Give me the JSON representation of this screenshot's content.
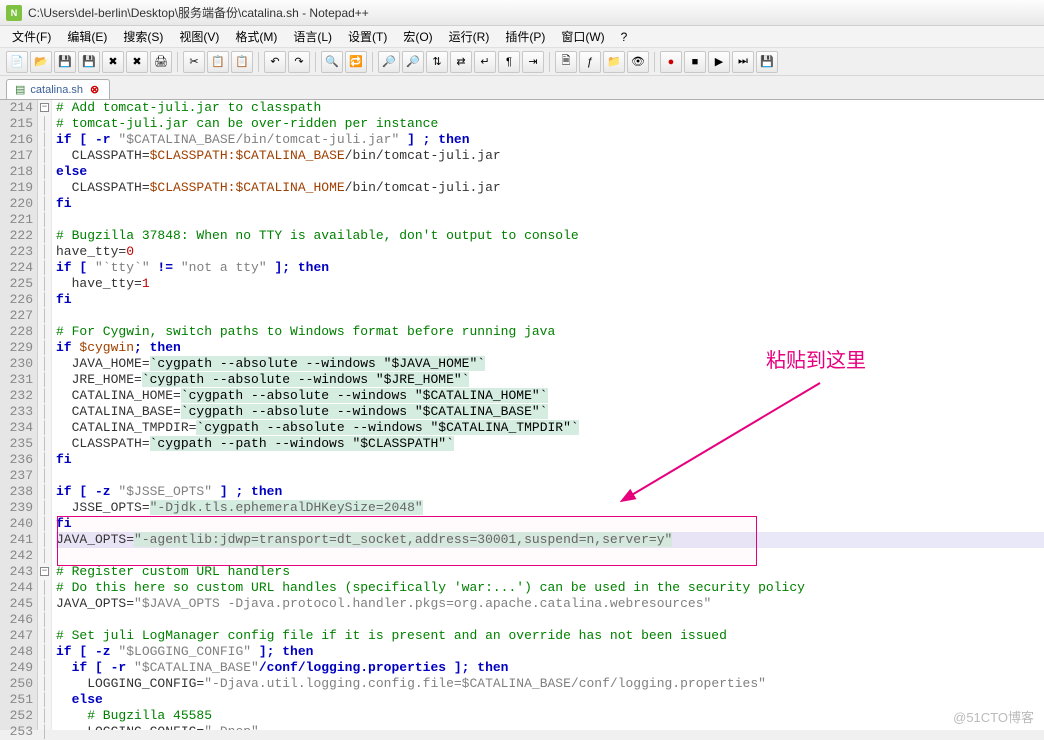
{
  "window": {
    "title": "C:\\Users\\del-berlin\\Desktop\\服务端备份\\catalina.sh - Notepad++"
  },
  "menu": {
    "file": "文件(F)",
    "edit": "编辑(E)",
    "search": "搜索(S)",
    "view": "视图(V)",
    "format": "格式(M)",
    "language": "语言(L)",
    "settings": "设置(T)",
    "macro": "宏(O)",
    "run": "运行(R)",
    "plugins": "插件(P)",
    "window": "窗口(W)",
    "help": "?"
  },
  "tab": {
    "name": "catalina.sh"
  },
  "lines": {
    "start": 214,
    "end": 253
  },
  "code": {
    "l214": "# Add tomcat-juli.jar to classpath",
    "l215": "# tomcat-juli.jar can be over-ridden per instance",
    "l216_a": "if [ -r ",
    "l216_b": "\"$CATALINA_BASE/bin/tomcat-juli.jar\"",
    "l216_c": " ] ; then",
    "l217_a": "  CLASSPATH=",
    "l217_b": "$CLASSPATH",
    "l217_c": ":",
    "l217_d": "$CATALINA_BASE",
    "l217_e": "/bin/tomcat-juli.jar",
    "l218": "else",
    "l219_a": "  CLASSPATH=",
    "l219_b": "$CLASSPATH",
    "l219_c": ":",
    "l219_d": "$CATALINA_HOME",
    "l219_e": "/bin/tomcat-juli.jar",
    "l220": "fi",
    "l221": "",
    "l222": "# Bugzilla 37848: When no TTY is available, don't output to console",
    "l223_a": "have_tty=",
    "l223_b": "0",
    "l224_a": "if [ ",
    "l224_b": "\"`tty`\"",
    "l224_c": " != ",
    "l224_d": "\"not a tty\"",
    "l224_e": " ]; then",
    "l225_a": "  have_tty=",
    "l225_b": "1",
    "l226": "fi",
    "l227": "",
    "l228": "# For Cygwin, switch paths to Windows format before running java",
    "l229_a": "if ",
    "l229_b": "$cygwin",
    "l229_c": "; then",
    "l230_a": "  JAVA_HOME=",
    "l230_b": "`cygpath --absolute --windows \"$JAVA_HOME\"`",
    "l231_a": "  JRE_HOME=",
    "l231_b": "`cygpath --absolute --windows \"$JRE_HOME\"`",
    "l232_a": "  CATALINA_HOME=",
    "l232_b": "`cygpath --absolute --windows \"$CATALINA_HOME\"`",
    "l233_a": "  CATALINA_BASE=",
    "l233_b": "`cygpath --absolute --windows \"$CATALINA_BASE\"`",
    "l234_a": "  CATALINA_TMPDIR=",
    "l234_b": "`cygpath --absolute --windows \"$CATALINA_TMPDIR\"`",
    "l235_a": "  CLASSPATH=",
    "l235_b": "`cygpath --path --windows \"$CLASSPATH\"`",
    "l236": "fi",
    "l237": "",
    "l238_a": "if [ -z ",
    "l238_b": "\"$JSSE_OPTS\"",
    "l238_c": " ] ; then",
    "l239_a": "  JSSE_OPTS=",
    "l239_b": "\"-Djdk.tls.ephemeralDHKeySize=2048\"",
    "l240": "fi",
    "l241_a": "JAVA_OPTS=",
    "l241_b": "\"-agentlib:jdwp=transport=dt_socket,address=30001,suspend=n,server=y\"",
    "l242": "",
    "l243": "# Register custom URL handlers",
    "l244": "# Do this here so custom URL handles (specifically 'war:...') can be used in the security policy",
    "l245_a": "JAVA_OPTS=",
    "l245_b": "\"$JAVA_OPTS -Djava.protocol.handler.pkgs=org.apache.catalina.webresources\"",
    "l246": "",
    "l247": "# Set juli LogManager config file if it is present and an override has not been issued",
    "l248_a": "if [ -z ",
    "l248_b": "\"$LOGGING_CONFIG\"",
    "l248_c": " ]; then",
    "l249_a": "  if [ -r ",
    "l249_b": "\"$CATALINA_BASE\"",
    "l249_c": "/conf/logging.properties ]; then",
    "l250_a": "    LOGGING_CONFIG=",
    "l250_b": "\"-Djava.util.logging.config.file=$CATALINA_BASE/conf/logging.properties\"",
    "l251": "  else",
    "l252": "    # Bugzilla 45585",
    "l253_a": "    LOGGING_CONFIG=",
    "l253_b": "\"-Dnop\""
  },
  "annotation": {
    "label": "粘贴到这里"
  },
  "watermark": "@51CTO博客"
}
